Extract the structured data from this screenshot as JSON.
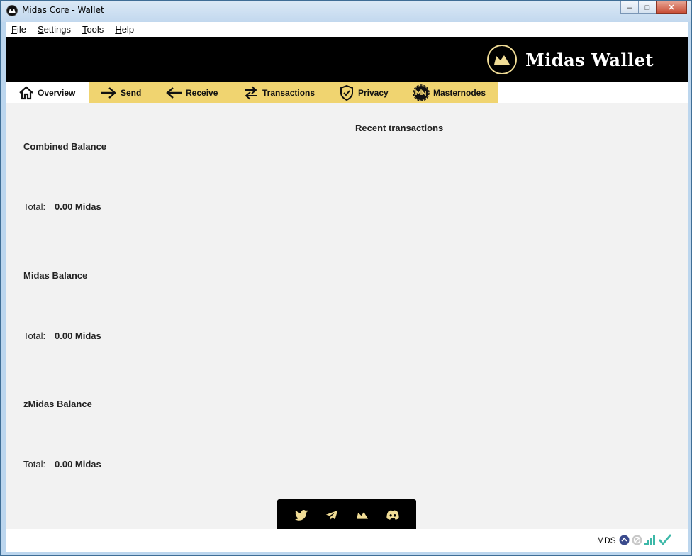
{
  "window": {
    "title": "Midas Core - Wallet"
  },
  "caption_buttons": {
    "minimize": "–",
    "maximize": "□",
    "close": "✕"
  },
  "menu": [
    {
      "accel": "F",
      "rest": "ile"
    },
    {
      "accel": "S",
      "rest": "ettings"
    },
    {
      "accel": "T",
      "rest": "ools"
    },
    {
      "accel": "H",
      "rest": "elp"
    }
  ],
  "brand": {
    "name": "Midas Wallet",
    "logo_icon": "midas-crown-icon",
    "accent": "#f0dc96"
  },
  "tabs": {
    "overview": {
      "label": "Overview",
      "icon": "home-icon"
    },
    "send": {
      "label": "Send",
      "icon": "arrow-right-icon"
    },
    "receive": {
      "label": "Receive",
      "icon": "arrow-left-icon"
    },
    "transactions": {
      "label": "Transactions",
      "icon": "swap-arrows-icon"
    },
    "privacy": {
      "label": "Privacy",
      "icon": "shield-check-icon"
    },
    "masternodes": {
      "label": "Masternodes",
      "icon": "masternode-icon"
    },
    "strip_color": "#f0d470"
  },
  "recent": {
    "title": "Recent transactions"
  },
  "balances": [
    {
      "title": "Combined Balance",
      "total_label": "Total:",
      "total_value": "0.00 Midas"
    },
    {
      "title": "Midas Balance",
      "total_label": "Total:",
      "total_value": "0.00 Midas"
    },
    {
      "title": "zMidas Balance",
      "total_label": "Total:",
      "total_value": "0.00 Midas"
    }
  ],
  "social": [
    "twitter-icon",
    "telegram-icon",
    "midas-icon",
    "discord-icon"
  ],
  "status": {
    "unit": "MDS",
    "icons": [
      "staking-icon",
      "privacy-disabled-icon",
      "signal-bars-icon",
      "synced-check-icon"
    ]
  }
}
